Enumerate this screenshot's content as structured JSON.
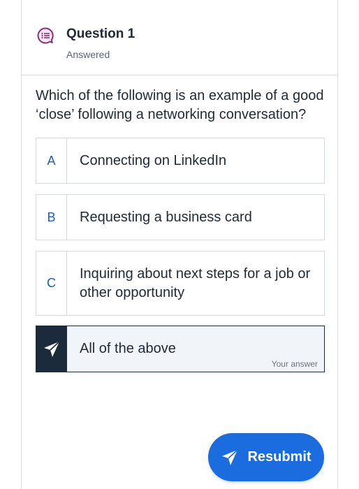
{
  "header": {
    "title": "Question 1",
    "status": "Answered"
  },
  "question": {
    "prompt": "Which of the following is an example of a good ‘close’ following a networking conversation?"
  },
  "options": [
    {
      "letter": "A",
      "text": "Connecting on LinkedIn"
    },
    {
      "letter": "B",
      "text": "Requesting a business card"
    },
    {
      "letter": "C",
      "text": "Inquiring about next steps for a job or other opportunity"
    },
    {
      "letter": "",
      "text": "All of the above",
      "selected": true,
      "tag": "Your answer"
    }
  ],
  "actions": {
    "resubmit_label": "Resubmit"
  },
  "icons": {
    "question": "question-chat-icon",
    "selected_marker": "send-icon",
    "resubmit": "send-icon"
  },
  "colors": {
    "accent": "#1b6ddf",
    "question_icon": "#8b2f7a",
    "selected_bg": "#1b2b3b",
    "letter": "#1b5fb8"
  }
}
